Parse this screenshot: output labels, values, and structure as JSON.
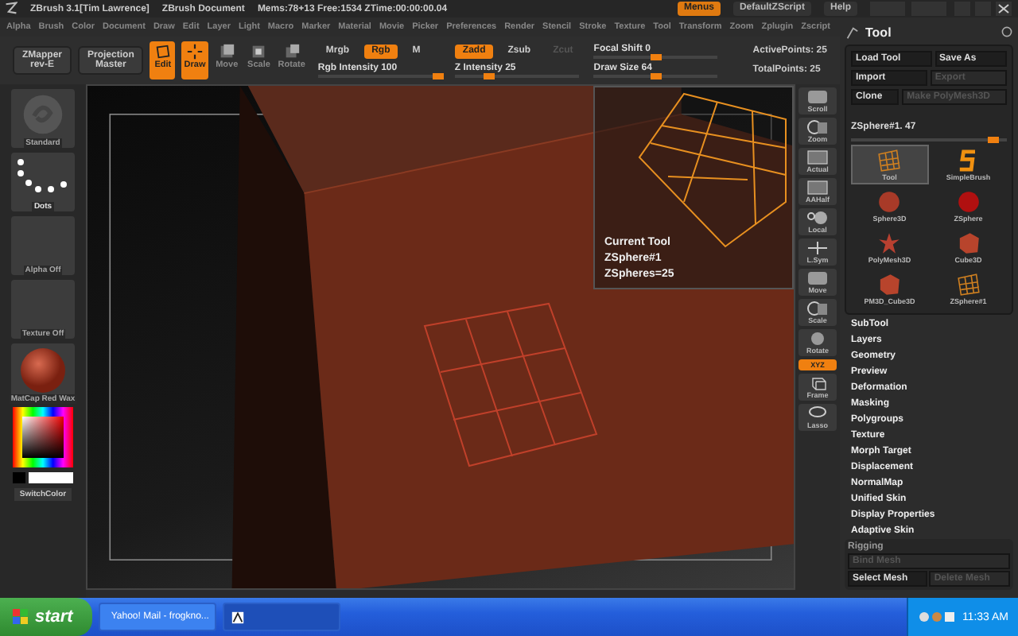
{
  "title_bar": {
    "app": "ZBrush 3.1[Tim Lawrence]",
    "document": "ZBrush Document",
    "stats": "Mems:78+13 Free:1534 ZTime:00:00:00.04",
    "right": [
      {
        "label": "Menus",
        "selected": true
      },
      {
        "label": "DefaultZScript",
        "selected": false
      },
      {
        "label": "Help",
        "selected": false
      }
    ]
  },
  "menu_bar": {
    "items": [
      "Alpha",
      "Brush",
      "Color",
      "Document",
      "Draw",
      "Edit",
      "Layer",
      "Light",
      "Macro",
      "Marker",
      "Material",
      "Movie",
      "Picker",
      "Preferences",
      "Render",
      "Stencil",
      "Stroke",
      "Texture",
      "Tool",
      "Transform",
      "Zoom",
      "Zplugin",
      "Zscript"
    ]
  },
  "toolbar": {
    "panels": [
      {
        "label": "ZMapper",
        "sub": "rev-E"
      },
      {
        "label": "Projection",
        "sub": "Master"
      }
    ],
    "modes": [
      {
        "label": "Edit",
        "kind": "edit",
        "selected": true
      },
      {
        "label": "Draw",
        "kind": "draw",
        "selected": true
      },
      {
        "label": "Move",
        "kind": "move",
        "selected": false
      },
      {
        "label": "Scale",
        "kind": "scale",
        "selected": false
      },
      {
        "label": "Rotate",
        "kind": "rotate",
        "selected": false
      }
    ],
    "rgb": {
      "toggles": [
        {
          "label": "Mrgb",
          "selected": false,
          "disabled": false
        },
        {
          "label": "Rgb",
          "selected": true,
          "disabled": false
        },
        {
          "label": "M",
          "selected": false,
          "disabled": false
        }
      ],
      "slider": {
        "label": "Rgb Intensity 100",
        "level": 1
      }
    },
    "z": {
      "toggles": [
        {
          "label": "Zadd",
          "selected": true,
          "disabled": false
        },
        {
          "label": "Zsub",
          "selected": false,
          "disabled": false
        },
        {
          "label": "Zcut",
          "selected": false,
          "disabled": true
        }
      ],
      "slider": {
        "label": "Z Intensity 25",
        "level": 0.25
      }
    },
    "brush_sliders": [
      {
        "label": "Focal Shift 0",
        "level": 0.5
      },
      {
        "label": "Draw Size 64",
        "level": 0.5
      }
    ],
    "info": [
      "ActivePoints: 25",
      "TotalPoints: 25"
    ]
  },
  "left_shelf": [
    {
      "label": "Standard",
      "kind": "brush",
      "disabled": true
    },
    {
      "label": "Dots",
      "kind": "stroke",
      "disabled": false
    },
    {
      "label": "Alpha Off",
      "kind": "empty",
      "disabled": true
    },
    {
      "label": "Texture Off",
      "kind": "empty",
      "disabled": true
    },
    {
      "label": "MatCap Red Wax",
      "kind": "material",
      "disabled": true
    }
  ],
  "color_picker": {
    "label": "SwitchColor"
  },
  "canvas": {
    "tooltip": [
      "Current Tool",
      "ZSphere#1",
      "ZSpheres=25"
    ]
  },
  "view_tools": [
    {
      "label": "Scroll",
      "kind": "hand",
      "selected": false
    },
    {
      "label": "Zoom",
      "kind": "zoom",
      "selected": false
    },
    {
      "label": "Actual",
      "kind": "frame",
      "selected": false
    },
    {
      "label": "AAHalf",
      "kind": "frame",
      "selected": false
    },
    {
      "label": "Local",
      "kind": "local",
      "selected": false
    },
    {
      "label": "L.Sym",
      "kind": "sym",
      "selected": false
    },
    {
      "label": "Move",
      "kind": "hand",
      "selected": false
    },
    {
      "label": "Scale",
      "kind": "zoom",
      "selected": false
    },
    {
      "label": "Rotate",
      "kind": "rotate",
      "selected": false
    },
    {
      "label": "XYZ",
      "kind": "axis",
      "selected": true
    },
    {
      "label": "Frame",
      "kind": "cube",
      "selected": false
    },
    {
      "label": "Lasso",
      "kind": "lasso",
      "selected": false
    }
  ],
  "tool_palette": {
    "title": "Tool",
    "button_rows": [
      [
        {
          "label": "Load Tool",
          "disabled": false
        },
        {
          "label": "Save As",
          "disabled": false
        }
      ],
      [
        {
          "label": "Import",
          "disabled": false
        },
        {
          "label": "Export",
          "disabled": true
        }
      ],
      [
        {
          "label": "Clone",
          "disabled": false
        },
        {
          "label": "Make PolyMesh3D",
          "disabled": true
        }
      ]
    ],
    "slider": {
      "label": "ZSphere#1. 47",
      "level": 0.95
    },
    "tools": [
      {
        "label": "Tool",
        "kind": "grid",
        "selected": true
      },
      {
        "label": "SimpleBrush",
        "kind": "brush",
        "selected": false
      },
      {
        "label": "Sphere3D",
        "kind": "sphere",
        "selected": false
      },
      {
        "label": "ZSphere",
        "kind": "ball",
        "selected": false
      },
      {
        "label": "PolyMesh3D",
        "kind": "star",
        "selected": false
      },
      {
        "label": "Cube3D",
        "kind": "cube",
        "selected": false
      },
      {
        "label": "PM3D_Cube3D",
        "kind": "cube",
        "selected": false
      },
      {
        "label": "ZSphere#1",
        "kind": "grid",
        "selected": false
      }
    ],
    "sections": [
      "SubTool",
      "Layers",
      "Geometry",
      "Preview",
      "Deformation",
      "Masking",
      "Polygroups",
      "Texture",
      "Morph Target",
      "Displacement",
      "NormalMap",
      "Unified Skin",
      "Display Properties",
      "Adaptive Skin"
    ],
    "rigging": {
      "title": "Rigging",
      "buttons": [
        {
          "label": "Bind Mesh",
          "disabled": true
        },
        {
          "label": "Select Mesh",
          "disabled": false
        },
        {
          "label": "Delete Mesh",
          "disabled": true
        }
      ]
    }
  },
  "taskbar": {
    "start": "start",
    "tasks": [
      {
        "label": "Yahoo! Mail - frogkno...",
        "kind": "mail",
        "selected": false
      },
      {
        "kind": "app",
        "selected": true
      }
    ],
    "clock": "11:33 AM"
  }
}
